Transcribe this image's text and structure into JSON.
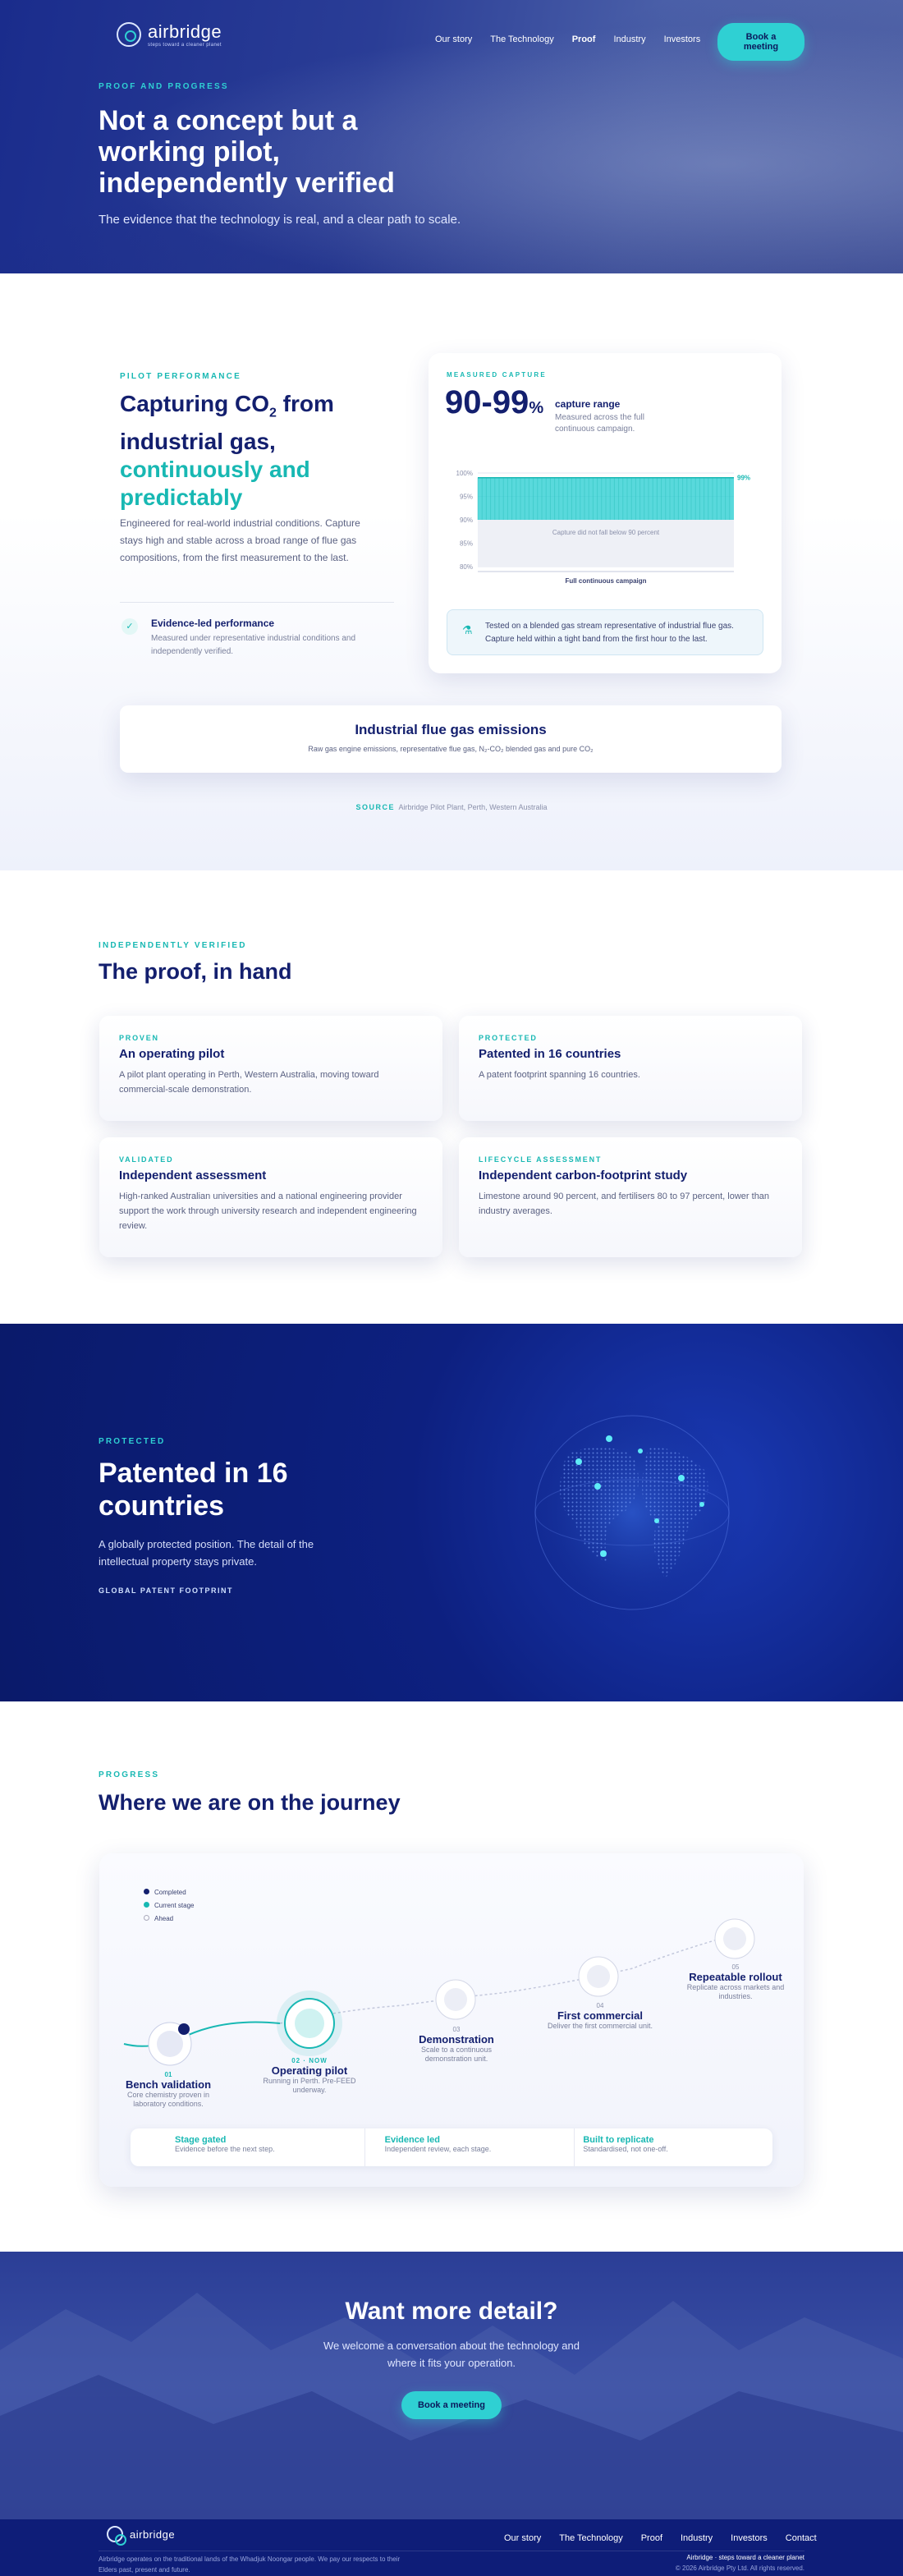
{
  "header": {
    "brand": "airbridge",
    "brand_tagline": "steps toward a cleaner planet",
    "nav": [
      "Our story",
      "The Technology",
      "Proof",
      "Industry",
      "Investors"
    ],
    "cta": "Book a meeting"
  },
  "hero": {
    "kicker": "PROOF AND PROGRESS",
    "title": "Not a concept but a working pilot, independently verified",
    "subtitle": "The evidence that the technology is real, and a clear path to scale."
  },
  "pilot": {
    "kicker": "PILOT PERFORMANCE",
    "title_a": "Capturing CO",
    "title_sub": "2",
    "title_b": " from industrial gas,",
    "title_c": "continuously and predictably",
    "body": "Engineered for real-world industrial conditions. Capture stays high and stable across a broad range of flue gas compositions, from the first measurement to the last.",
    "feature_title": "Evidence-led performance",
    "feature_body": "Measured under representative industrial conditions and independently verified.",
    "measured_kicker": "MEASURED CAPTURE",
    "big_value": "90-99",
    "big_unit": "%",
    "range_label": "capture range",
    "range_desc": "Measured across the full continuous campaign.",
    "chart_note": "Tested on a blended gas stream representative of industrial flue gas. Capture held within a tight band from the first hour to the last.",
    "source_label": "SOURCE",
    "source": "Airbridge Pilot Plant, Perth, Western Australia",
    "emissions_title": "Industrial flue gas emissions",
    "emissions_desc": "Raw gas engine emissions, representative flue gas, N₂-CO₂ blended gas and pure CO₂"
  },
  "chart_data": {
    "type": "area",
    "ylim": [
      80,
      100
    ],
    "yticks": [
      "100%",
      "95%",
      "90%",
      "85%",
      "80%"
    ],
    "upper": 99,
    "lower": 90,
    "end_label": "99%",
    "band_note": "Capture did not fall below 90 percent",
    "xlabel": "Full continuous campaign"
  },
  "proof": {
    "kicker": "INDEPENDENTLY VERIFIED",
    "title": "The proof, in hand",
    "cards": [
      {
        "k": "PROVEN",
        "t": "An operating pilot",
        "d": "A pilot plant operating in Perth, Western Australia, moving toward commercial-scale demonstration."
      },
      {
        "k": "PROTECTED",
        "t": "Patented in 16 countries",
        "d": "A patent footprint spanning 16 countries."
      },
      {
        "k": "VALIDATED",
        "t": "Independent assessment",
        "d": "High-ranked Australian universities and a national engineering provider support the work through university research and independent engineering review."
      },
      {
        "k": "LIFECYCLE ASSESSMENT",
        "t": "Independent carbon-footprint study",
        "d": "Limestone around 90 percent, and fertilisers 80 to 97 percent, lower than industry averages."
      }
    ]
  },
  "patent": {
    "kicker": "PROTECTED",
    "title": "Patented in 16 countries",
    "body": "A globally protected position. The detail of the intellectual property stays private.",
    "sub": "GLOBAL PATENT FOOTPRINT"
  },
  "journey": {
    "kicker": "PROGRESS",
    "title": "Where we are on the journey",
    "legend": [
      "Completed",
      "Current stage",
      "Ahead"
    ],
    "stages": [
      {
        "n": "01",
        "t": "Bench validation",
        "d": "Core chemistry proven in laboratory conditions."
      },
      {
        "n": "02 · NOW",
        "t": "Operating pilot",
        "d": "Running in Perth. Pre-FEED underway."
      },
      {
        "n": "03",
        "t": "Demonstration",
        "d": "Scale to a continuous demonstration unit."
      },
      {
        "n": "04",
        "t": "First commercial",
        "d": "Deliver the first commercial unit."
      },
      {
        "n": "05",
        "t": "Repeatable rollout",
        "d": "Replicate across markets and industries."
      }
    ],
    "pillars": [
      {
        "t": "Stage gated",
        "d": "Evidence before the next step."
      },
      {
        "t": "Evidence led",
        "d": "Independent review, each stage."
      },
      {
        "t": "Built to replicate",
        "d": "Standardised, not one-off."
      }
    ]
  },
  "cta": {
    "title": "Want more detail?",
    "body": "We welcome a conversation about the technology and where it fits your operation.",
    "button": "Book a meeting"
  },
  "footer": {
    "nav": [
      "Our story",
      "The Technology",
      "Proof",
      "Industry",
      "Investors",
      "Contact"
    ],
    "ack": "Airbridge operates on the traditional lands of the Whadjuk Noongar people. We pay our respects to their Elders past, present and future.",
    "tag": "Airbridge · steps toward a cleaner planet",
    "copy": "© 2026 Airbridge Pty Ltd. All rights reserved."
  }
}
